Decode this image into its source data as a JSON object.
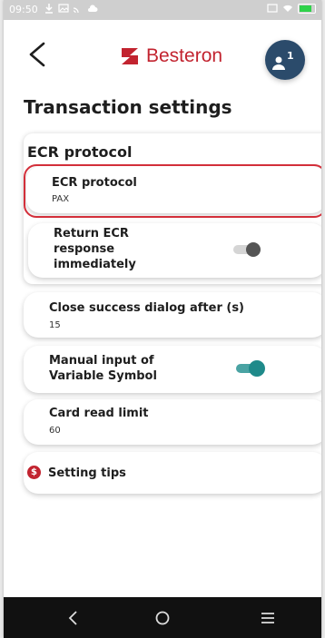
{
  "status_bar": {
    "time": "09:50"
  },
  "header": {
    "brand": "Besteron",
    "notification_count": "1"
  },
  "page_title": "Transaction settings",
  "ecr_group": {
    "title": "ECR protocol",
    "protocol": {
      "label": "ECR protocol",
      "value": "PAX"
    },
    "return_response": {
      "label": "Return ECR response immediately",
      "enabled": false
    }
  },
  "settings": {
    "close_dialog": {
      "label": "Close success dialog after (s)",
      "value": "15"
    },
    "manual_input": {
      "label": "Manual input of Variable Symbol",
      "enabled": true
    },
    "card_read_limit": {
      "label": "Card read limit",
      "value": "60"
    },
    "setting_tips": {
      "label": "Setting tips",
      "icon": "dollar-icon"
    }
  },
  "colors": {
    "brand_red": "#c2232f",
    "toggle_on": "#1f8a8a",
    "toggle_off": "#d5d5d5",
    "highlight": "#d32f3a",
    "avatar": "#2b4b6b"
  }
}
